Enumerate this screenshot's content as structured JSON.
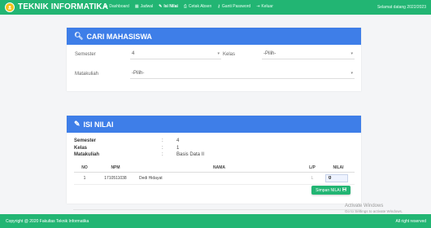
{
  "brand": "TEKNIK INFORMATIKA",
  "nav": [
    {
      "label": "Dashboard",
      "icon": "dashboard-icon",
      "glyph": "◉",
      "active": false
    },
    {
      "label": "Jadwal",
      "icon": "calendar-icon",
      "glyph": "▦",
      "active": false
    },
    {
      "label": "Isi Nilai",
      "icon": "pencil-icon",
      "glyph": "✎",
      "active": true
    },
    {
      "label": "Cetak Absen",
      "icon": "print-icon",
      "glyph": "⎙",
      "active": false
    },
    {
      "label": "Ganti Password",
      "icon": "key-icon",
      "glyph": "⚷",
      "active": false
    },
    {
      "label": "Keluar",
      "icon": "logout-icon",
      "glyph": "⇥",
      "active": false
    }
  ],
  "welcome": "Selamat datang 2022/2023",
  "search_card": {
    "title": "CARI MAHASISWA",
    "semester_label": "Semester",
    "semester_value": "4",
    "kelas_label": "Kelas",
    "kelas_value": "-Pilih-",
    "matakuliah_label": "Matakuliah",
    "matakuliah_value": "-Pilih-"
  },
  "nilai_card": {
    "title": "ISI NILAI",
    "info": [
      {
        "key": "Semester",
        "value": "4"
      },
      {
        "key": "Kelas",
        "value": "1"
      },
      {
        "key": "Matakuliah",
        "value": "Basis Data II"
      }
    ],
    "columns": [
      "NO",
      "NPM",
      "NAMA",
      "L/P",
      "NILAI"
    ],
    "rows": [
      {
        "no": "1",
        "npm": "1710511038",
        "nama": "Dedi Hidayat",
        "lp": "L",
        "nilai": "0"
      }
    ],
    "save_label": "Simpan NILAI"
  },
  "footer": {
    "left": "Copyright @ 2020 Fakultas Teknik Informatika",
    "right": "All right reserved"
  },
  "watermark": {
    "title": "Activate Windows",
    "subtitle": "Go to Settings to activate Windows."
  }
}
